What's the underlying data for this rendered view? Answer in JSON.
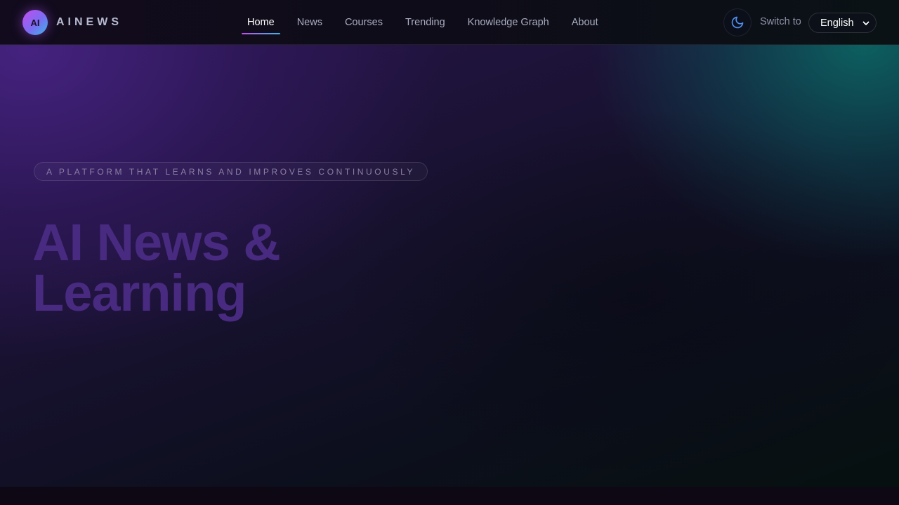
{
  "brand": {
    "logo_badge": "AI",
    "name": "AINEWS"
  },
  "nav": {
    "items": [
      {
        "label": "Home",
        "active": true
      },
      {
        "label": "News",
        "active": false
      },
      {
        "label": "Courses",
        "active": false
      },
      {
        "label": "Trending",
        "active": false
      },
      {
        "label": "Knowledge Graph",
        "active": false
      },
      {
        "label": "About",
        "active": false
      }
    ]
  },
  "controls": {
    "theme_icon": "moon-icon",
    "switch_label": "Switch to",
    "language": "English"
  },
  "hero": {
    "tagline": "A PLATFORM THAT LEARNS AND IMPROVES CONTINUOUSLY",
    "title_line1": "AI News &",
    "title_line2": "Learning"
  },
  "colors": {
    "accent_gradient_start": "#c54bf0",
    "accent_gradient_end": "#39b8e8",
    "title_color": "#482a80",
    "background_teal": "#0a6e69",
    "background_purple": "#46237f"
  }
}
